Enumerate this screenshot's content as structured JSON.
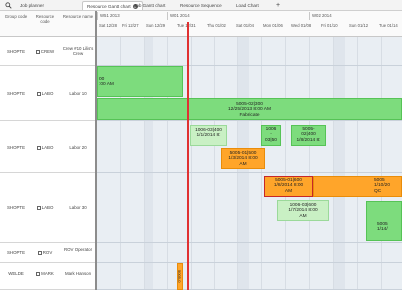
{
  "tabs": [
    {
      "label": "Job planner",
      "active": false
    },
    {
      "label": "Resource Gantt chart",
      "active": true
    },
    {
      "label": "Job Gantt chart",
      "active": false
    },
    {
      "label": "Resource Sequence",
      "active": false
    },
    {
      "label": "Load Chart",
      "active": false
    }
  ],
  "add_tab_symbol": "+",
  "close_symbol": "x",
  "left_headers": {
    "group": "Group code",
    "resource": "Resource code",
    "name": "Resource name"
  },
  "rows": [
    {
      "group": "SHOPTE",
      "resource": "CREW",
      "name": "Crew #10 Lilis's Crew"
    },
    {
      "group": "SHOPTE",
      "resource": "LABO",
      "name": "Labor 10"
    },
    {
      "group": "SHOPTE",
      "resource": "LABO",
      "name": "Labor 20"
    },
    {
      "group": "SHOPTE",
      "resource": "LABO",
      "name": "Labor 30"
    },
    {
      "group": "SHOPTE",
      "resource": "ROV",
      "name": "ROV Operator"
    },
    {
      "group": "WELDE",
      "resource": "MARK",
      "name": "Mark Hanson"
    }
  ],
  "weeks": [
    "W51 2013",
    "W01 2014",
    "W02 2014"
  ],
  "days": [
    "Sat 12/28",
    "Fri 12/27",
    "Sun 12/29",
    "Tue 12/31",
    "Thu 01/02",
    "Sat 01/04",
    "Mon 01/06",
    "Wed 01/08",
    "Fri 01/10",
    "Sun 01/12",
    "Tue 01/14"
  ],
  "bars": [
    {
      "id": "b1",
      "color": "green",
      "text": "00\n:00 AM"
    },
    {
      "id": "b2",
      "color": "green",
      "text": "5005-02|300\n12/25/2013 8:00 AM\nFabricate"
    },
    {
      "id": "b3",
      "color": "greenl",
      "text": "1006-03|400\n1/1/2014 8:"
    },
    {
      "id": "b4",
      "color": "green",
      "text": "1006\n-\n03|50"
    },
    {
      "id": "b5",
      "color": "green",
      "text": "5005-\n02|400\n1/8/2014 8:"
    },
    {
      "id": "b6",
      "color": "orange",
      "text": "5005-01|500\n1/3/2014 8:00\nAM"
    },
    {
      "id": "b7",
      "color": "orangesel",
      "text": "5005-01|600\n1/8/2014 8:00\nAM"
    },
    {
      "id": "b8",
      "color": "orange",
      "text": "5005\n1/10/20\nQC"
    },
    {
      "id": "b9",
      "color": "greenl",
      "text": "1006-03|600\n1/7/2014 8:00\nAM"
    },
    {
      "id": "b10",
      "color": "green",
      "text": "5005\n1/14/"
    },
    {
      "id": "b11",
      "color": "orange",
      "text": "5005-0"
    }
  ]
}
